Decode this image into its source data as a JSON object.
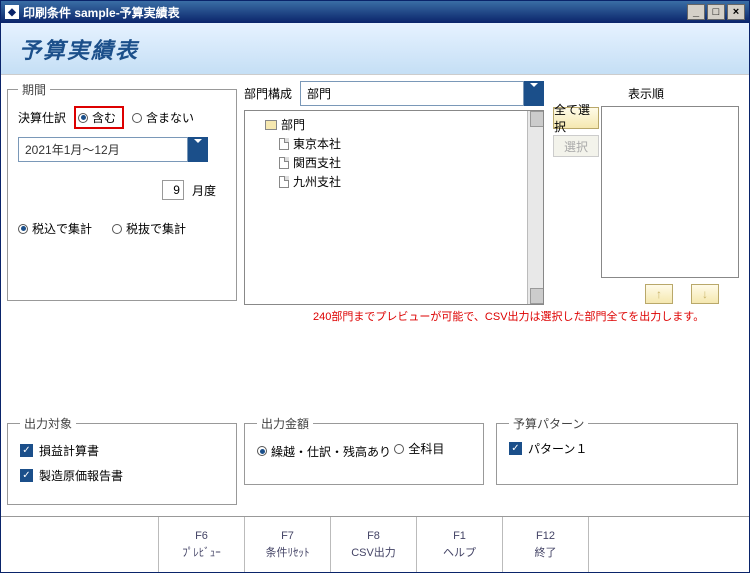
{
  "window": {
    "title": "印刷条件 sample-予算実績表"
  },
  "header": {
    "title": "予算実績表"
  },
  "period": {
    "legend": "期間",
    "settlement_label": "決算仕訳",
    "include": "含む",
    "exclude": "含まない",
    "range": "2021年1月～12月",
    "month_value": "9",
    "month_suffix": "月度",
    "tax_in": "税込で集計",
    "tax_ex": "税抜で集計"
  },
  "dept": {
    "label": "部門構成",
    "selected": "部門",
    "tree_root": "部門",
    "nodes": [
      "東京本社",
      "関西支社",
      "九州支社"
    ]
  },
  "order": {
    "label": "表示順",
    "select_all": "全て選択",
    "select": "選択",
    "warn": "240部門までプレビューが可能で、CSV出力は選択した部門全てを出力します。"
  },
  "output_target": {
    "legend": "出力対象",
    "items": [
      "損益計算書",
      "製造原価報告書"
    ]
  },
  "output_amount": {
    "legend": "出力金額",
    "opt1": "繰越・仕訳・残高あり",
    "opt2": "全科目"
  },
  "pattern": {
    "legend": "予算パターン",
    "item": "パターン１"
  },
  "footer": [
    {
      "key": "F6",
      "label": "ﾌﾟﾚﾋﾞｭｰ"
    },
    {
      "key": "F7",
      "label": "条件ﾘｾｯﾄ"
    },
    {
      "key": "F8",
      "label": "CSV出力"
    },
    {
      "key": "F1",
      "label": "ヘルプ"
    },
    {
      "key": "F12",
      "label": "終了"
    }
  ]
}
